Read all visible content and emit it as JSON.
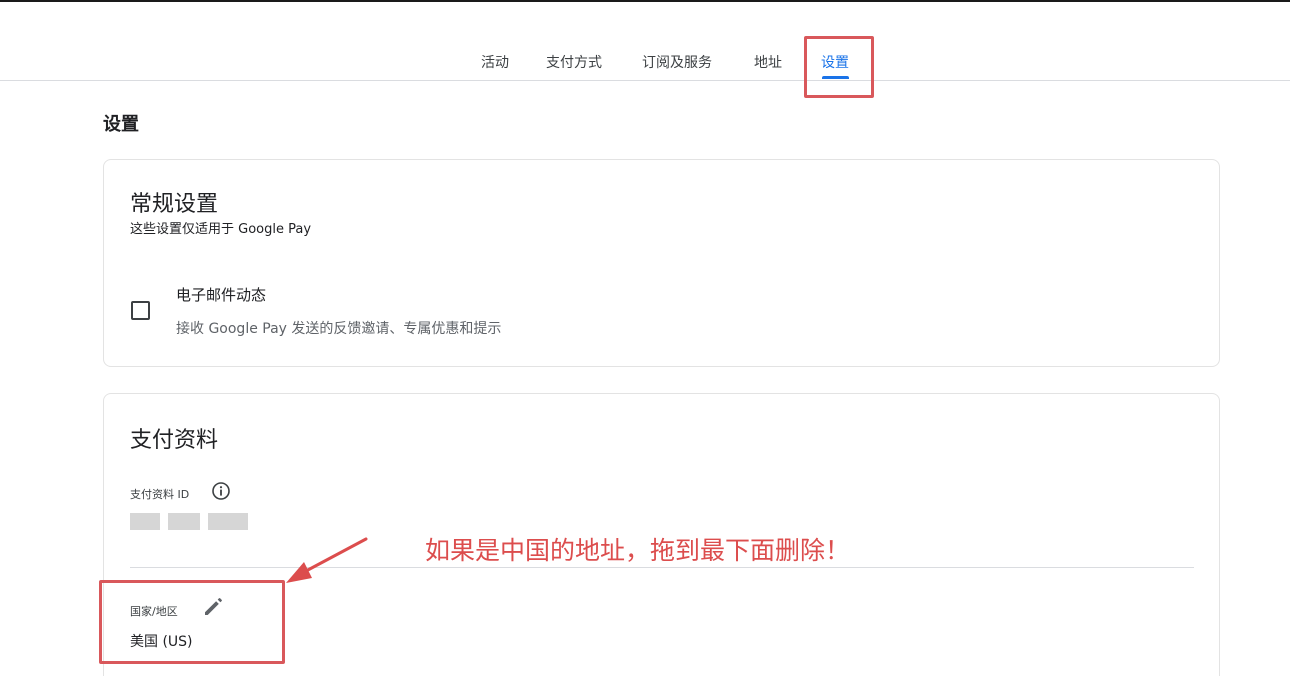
{
  "tabs": [
    {
      "label": "活动"
    },
    {
      "label": "支付方式"
    },
    {
      "label": "订阅及服务"
    },
    {
      "label": "地址"
    },
    {
      "label": "设置",
      "active": true
    }
  ],
  "page": {
    "title": "设置"
  },
  "general_settings": {
    "title": "常规设置",
    "subtitle": "这些设置仅适用于 Google Pay",
    "email_option": {
      "title": "电子邮件动态",
      "description": "接收 Google Pay 发送的反馈邀请、专属优惠和提示",
      "checked": false
    }
  },
  "payment_profile": {
    "title": "支付资料",
    "id_label": "支付资料 ID",
    "country_label": "国家/地区",
    "country_value": "美国 (US)"
  },
  "annotation": {
    "text": "如果是中国的地址，拖到最下面删除！",
    "color": "#dc4d4d"
  },
  "colors": {
    "accent": "#1a73e8",
    "highlight": "#d9585b"
  },
  "icons": {
    "info": "info-icon",
    "edit": "pencil-icon"
  }
}
